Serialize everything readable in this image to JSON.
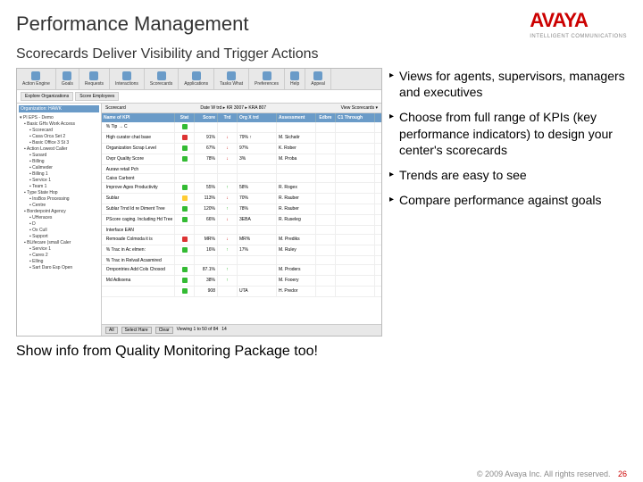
{
  "header": {
    "title": "Performance Management",
    "logo": "AVAYA",
    "tagline": "INTELLIGENT COMMUNICATIONS",
    "subtitle": "Scorecards Deliver Visibility and Trigger Actions"
  },
  "toolbar": {
    "items": [
      "Action Engine",
      "Goals",
      "Requests",
      "Interactions",
      "Scorecards",
      "Applications",
      "Tasks What",
      "Preferences",
      "Help",
      "Appeal"
    ]
  },
  "tabs": {
    "a": "Explore Organizations",
    "b": "Score Employees"
  },
  "filters": {
    "date_label": "Date",
    "date_from": "W trd",
    "date_to": "KR 3007",
    "date_suffix": "KRA 807",
    "view_label": "View",
    "view_value": "Scorecards"
  },
  "tree": {
    "header": "Organization: HAWK",
    "items": [
      {
        "t": "PI EPS - Demo",
        "i": 0
      },
      {
        "t": "Basic GHs Work Access",
        "i": 1
      },
      {
        "t": "Scorecard",
        "i": 2
      },
      {
        "t": "Casa Orca Set 2",
        "i": 2
      },
      {
        "t": "Basic Office 3 St 3",
        "i": 2
      },
      {
        "t": "Action Lowest Caller",
        "i": 1
      },
      {
        "t": "Suoard",
        "i": 2
      },
      {
        "t": "Billing",
        "i": 2
      },
      {
        "t": "Calimeder",
        "i": 2
      },
      {
        "t": "Billing 1",
        "i": 2
      },
      {
        "t": "Service 1",
        "i": 2
      },
      {
        "t": "Team 1",
        "i": 2
      },
      {
        "t": "Type State Hop",
        "i": 1
      },
      {
        "t": "InsBox Processing",
        "i": 2
      },
      {
        "t": "Centre",
        "i": 2
      },
      {
        "t": "Borderpoint Agency",
        "i": 1
      },
      {
        "t": "UHeraces",
        "i": 2
      },
      {
        "t": "D",
        "i": 2
      },
      {
        "t": "Ox Cull",
        "i": 2
      },
      {
        "t": "Support",
        "i": 2
      },
      {
        "t": "BLifecare (small Caler",
        "i": 1
      },
      {
        "t": "Service 1",
        "i": 2
      },
      {
        "t": "Cares 2",
        "i": 2
      },
      {
        "t": "Elling",
        "i": 2
      },
      {
        "t": "Sart Daro Esp Open",
        "i": 2
      }
    ]
  },
  "grid": {
    "scorecard_label": "Scorecard",
    "headers": {
      "name": "Name of KPI",
      "stat": "Stat",
      "score": "Score",
      "trend": "Trd",
      "org": "Org X trd",
      "assess": "Assessment",
      "more": "Edbre",
      "ct": "C1 Through"
    },
    "rows": [
      {
        "name": "% Tip → C",
        "stat": "g",
        "score": "",
        "trend": "",
        "org": "",
        "assess": ""
      },
      {
        "name": "High curator chat base",
        "stat": "r",
        "score": "91%",
        "trend": "dn",
        "org": "79% ↑",
        "assess": "M. Sichatir"
      },
      {
        "name": "Organization Scrap Level",
        "stat": "g",
        "score": "67%",
        "trend": "dn",
        "org": "97%",
        "assess": "K. Rober"
      },
      {
        "name": "Ovpr Quality Score",
        "stat": "g",
        "score": "78%",
        "trend": "dn",
        "org": "3%",
        "assess": "M. Proba"
      },
      {
        "name": "Auraw retail Pch",
        "stat": "",
        "score": "",
        "trend": "",
        "org": "",
        "assess": ""
      },
      {
        "name": "Caiss Carbont",
        "stat": "",
        "score": "",
        "trend": "",
        "org": "",
        "assess": ""
      },
      {
        "name": "Improve Ages Productivity",
        "stat": "g",
        "score": "55%",
        "trend": "up",
        "org": "58%",
        "assess": "R. Rogex"
      },
      {
        "name": "Sublar",
        "stat": "y",
        "score": "113%",
        "trend": "dn",
        "org": "70%",
        "assess": "R. Rauber"
      },
      {
        "name": "Sublar Trnd Id re Diment Tree",
        "stat": "g",
        "score": "120%",
        "trend": "up",
        "org": "78%",
        "assess": "R. Rauber"
      },
      {
        "name": "PScore caging. Including Hd Tree",
        "stat": "g",
        "score": "66%",
        "trend": "dn",
        "org": "3EBA",
        "assess": "R. Ruseleg"
      },
      {
        "name": "Interface EAN",
        "stat": "",
        "score": "",
        "trend": "",
        "org": "",
        "assess": ""
      },
      {
        "name": "Remoade Colmoda it is",
        "stat": "r",
        "score": "MR%",
        "trend": "dn",
        "org": "MR%",
        "assess": "M. Prediks"
      },
      {
        "name": "% Trac in Ac elmen:",
        "stat": "g",
        "score": "16%",
        "trend": "up",
        "org": "17%",
        "assess": "M. Ruley"
      },
      {
        "name": "% Trac in Relvail Acasmired",
        "stat": "",
        "score": "",
        "trend": "",
        "org": "",
        "assess": ""
      },
      {
        "name": "Ornpontries Add Cols Chosod",
        "stat": "g",
        "score": "87.1%",
        "trend": "up",
        "org": "",
        "assess": "M. Proders"
      },
      {
        "name": "Md Adkxena",
        "stat": "g",
        "score": "38%",
        "trend": "up",
        "org": "",
        "assess": "M. Fooery"
      },
      {
        "name": "",
        "stat": "g",
        "score": "908",
        "trend": "",
        "org": "UTA",
        "assess": "H. Predor"
      }
    ],
    "footer": {
      "all": "All",
      "select": "Select Hare",
      "clear": "Clear",
      "paging": "Viewing 1 to 50 of 84",
      "pg": "14"
    }
  },
  "bullets": [
    "Views for agents, supervisors, managers and executives",
    "Choose from full range of KPIs (key performance indicators) to design your center's scorecards",
    "Trends are easy to see",
    "Compare performance against goals"
  ],
  "callout": "Show info from Quality Monitoring Package too!",
  "footer": {
    "copyright": "© 2009 Avaya Inc. All rights reserved.",
    "page": "26"
  }
}
